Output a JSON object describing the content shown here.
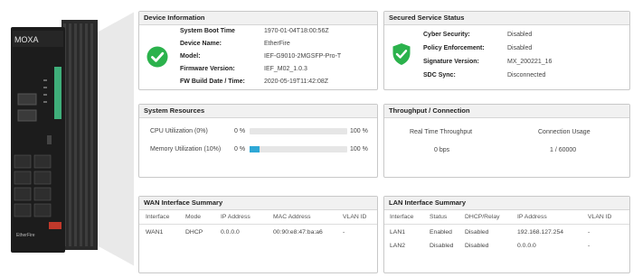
{
  "device": {
    "brand": "MOXA",
    "model_label": "EtherFire"
  },
  "device_info": {
    "title": "Device Information",
    "rows": [
      {
        "label": "System Boot Time",
        "value": "1970-01-04T18:00:56Z"
      },
      {
        "label": "Device Name:",
        "value": "EtherFire"
      },
      {
        "label": "Model:",
        "value": "IEF-G9010-2MGSFP-Pro-T"
      },
      {
        "label": "Firmware Version:",
        "value": "IEF_M02_1.0.3"
      },
      {
        "label": "FW Build Date / Time:",
        "value": "2020-05-19T11:42:08Z"
      }
    ]
  },
  "secured_service": {
    "title": "Secured Service Status",
    "rows": [
      {
        "label": "Cyber Security:",
        "value": "Disabled"
      },
      {
        "label": "Policy Enforcement:",
        "value": "Disabled"
      },
      {
        "label": "Signature Version:",
        "value": "MX_200221_16"
      },
      {
        "label": "SDC Sync:",
        "value": "Disconnected"
      }
    ]
  },
  "system_resources": {
    "title": "System Resources",
    "cpu": {
      "label": "CPU Utilization (0%)",
      "min": "0 %",
      "max": "100 %",
      "percent": 0
    },
    "memory": {
      "label": "Memory Utilization (10%)",
      "min": "0 %",
      "max": "100 %",
      "percent": 10
    }
  },
  "throughput": {
    "title": "Throughput / Connection",
    "realtime_label": "Real Time Throughput",
    "realtime_value": "0 bps",
    "conn_label": "Connection Usage",
    "conn_value": "1 / 60000"
  },
  "wan": {
    "title": "WAN Interface Summary",
    "headers": [
      "Interface",
      "Mode",
      "IP Address",
      "MAC Address",
      "VLAN ID"
    ],
    "rows": [
      [
        "WAN1",
        "DHCP",
        "0.0.0.0",
        "00:90:e8:47:ba:a6",
        "-"
      ]
    ]
  },
  "lan": {
    "title": "LAN Interface Summary",
    "headers": [
      "Interface",
      "Status",
      "DHCP/Relay",
      "IP Address",
      "VLAN ID"
    ],
    "rows": [
      [
        "LAN1",
        "Enabled",
        "Disabled",
        "192.168.127.254",
        "-"
      ],
      [
        "LAN2",
        "Disabled",
        "Disabled",
        "0.0.0.0",
        "-"
      ]
    ]
  },
  "colors": {
    "ok_green": "#2bb24c",
    "bar_blue": "#2fa8d6",
    "panel_header": "#f1f1f1"
  }
}
